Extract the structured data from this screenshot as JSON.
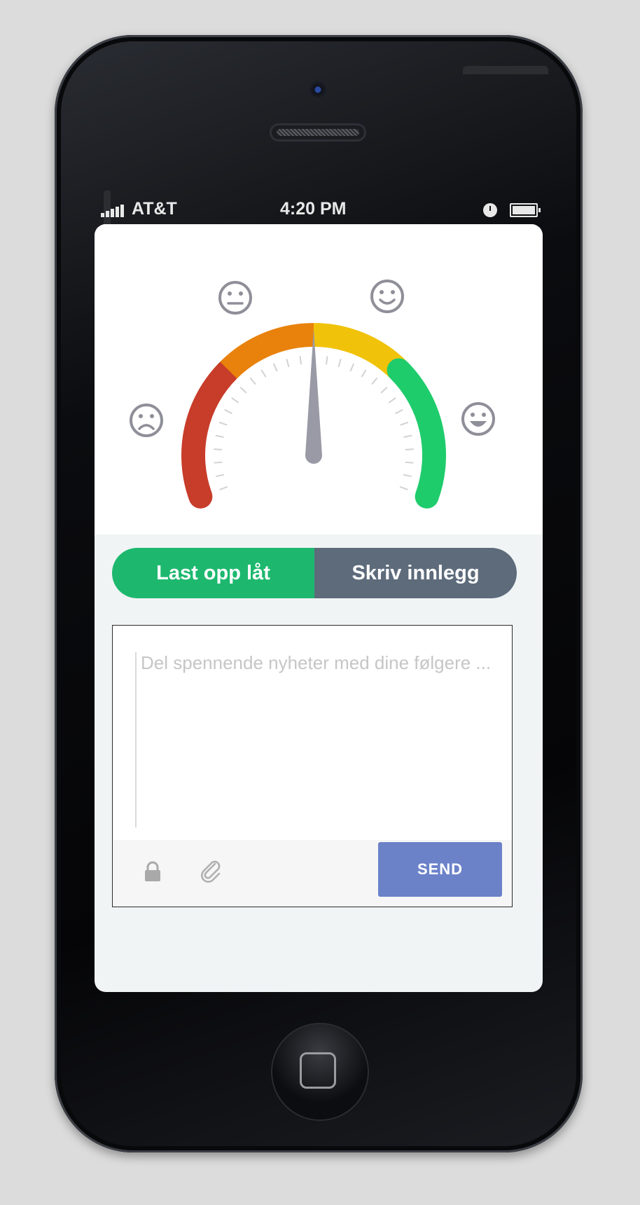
{
  "status_bar": {
    "carrier": "AT&T",
    "time": "4:20 PM"
  },
  "gauge": {
    "faces": [
      "sad-face-icon",
      "neutral-face-icon",
      "happy-face-icon",
      "grinning-face-icon"
    ],
    "segment_colors": [
      "#c83c2a",
      "#e8820c",
      "#f0c20a",
      "#1fcc6c"
    ],
    "needle_color": "#9a9aa6",
    "tick_count": 29,
    "needle_value": 0.5
  },
  "toggle": {
    "left_label": "Last opp låt",
    "right_label": "Skriv innlegg"
  },
  "composer": {
    "placeholder": "Del spennende nyheter med dine følgere ...",
    "value": "",
    "send_label": "SEND"
  },
  "colors": {
    "accent_green": "#1db86e",
    "toggle_gray": "#5d6b7b",
    "send_blue": "#6b82c9"
  }
}
